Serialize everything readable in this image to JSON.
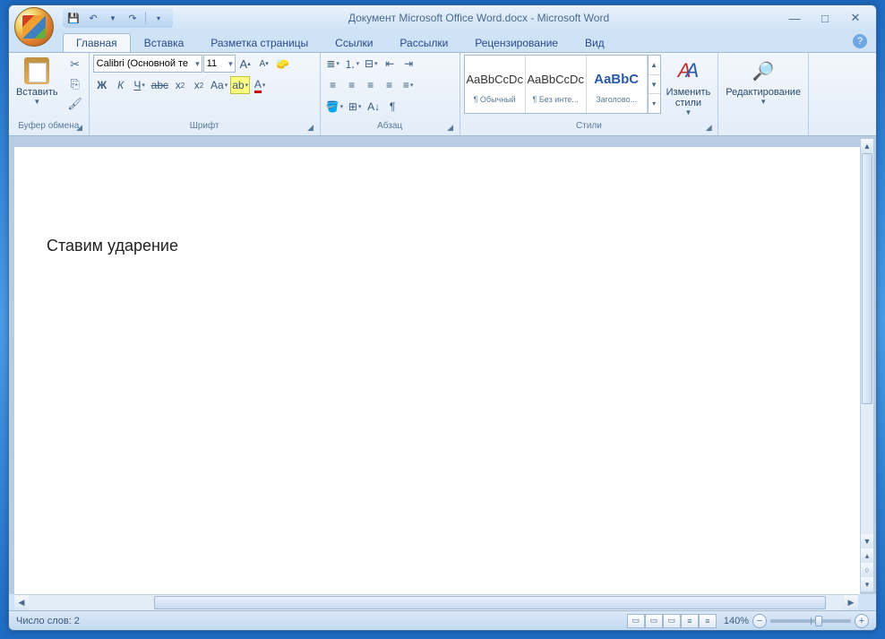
{
  "title": "Документ Microsoft Office Word.docx - Microsoft Word",
  "qat": {
    "save": "💾",
    "undo": "↶",
    "redo": "↷",
    "more": "▾"
  },
  "tabs": [
    "Главная",
    "Вставка",
    "Разметка страницы",
    "Ссылки",
    "Рассылки",
    "Рецензирование",
    "Вид"
  ],
  "groups": {
    "clipboard": {
      "label": "Буфер обмена",
      "paste": "Вставить"
    },
    "font": {
      "label": "Шрифт",
      "name": "Calibri (Основной те",
      "size": "11"
    },
    "paragraph": {
      "label": "Абзац"
    },
    "styles": {
      "label": "Стили",
      "items": [
        {
          "preview": "AaBbCcDc",
          "name": "¶ Обычный",
          "cls": ""
        },
        {
          "preview": "AaBbCcDc",
          "name": "¶ Без инте...",
          "cls": ""
        },
        {
          "preview": "AaBbC",
          "name": "Заголово...",
          "cls": "heading"
        }
      ],
      "change": "Изменить\nстили"
    },
    "editing": {
      "label": "Редактирование"
    }
  },
  "document_text": "Ставим ударение",
  "statusbar": {
    "wordcount": "Число слов: 2",
    "zoom": "140%"
  }
}
